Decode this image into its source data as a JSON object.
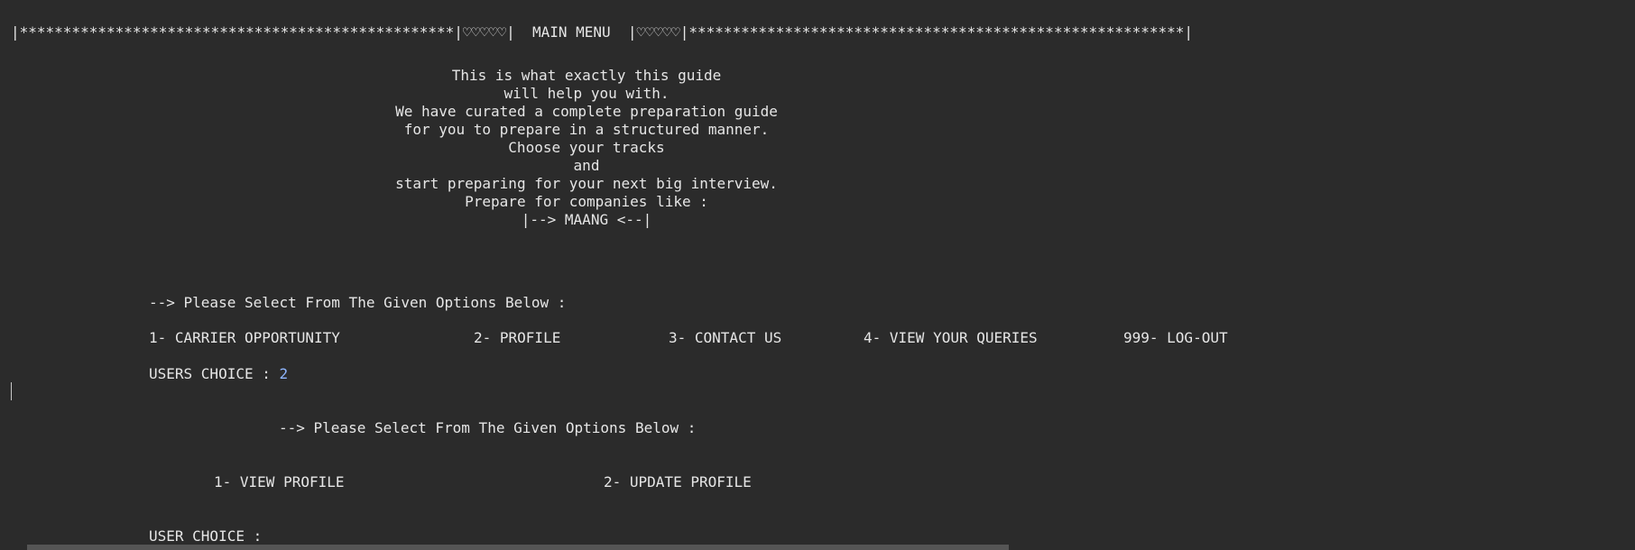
{
  "console": {
    "header_banner": "|**************************************************|♡♡♡♡♡|  MAIN MENU  |♡♡♡♡♡|*********************************************************|",
    "intro_lines": [
      "This is what exactly this guide",
      "will help you with.",
      "We have curated a complete preparation guide",
      "for you to prepare in a structured manner.",
      "Choose your tracks",
      "and",
      "start preparing for your next big interview.",
      "Prepare for companies like :",
      "|--> MAANG <--|"
    ],
    "main_prompt": "--> Please Select From The Given Options Below :",
    "main_options": [
      "1- CARRIER OPPORTUNITY",
      "2- PROFILE",
      "3- CONTACT US",
      "4- VIEW YOUR QUERIES",
      "999- LOG-OUT"
    ],
    "users_choice_label": "USERS CHOICE : ",
    "users_choice_value": "2",
    "sub_prompt": "--> Please Select From The Given Options Below :",
    "profile_options": [
      "1- VIEW PROFILE",
      "2- UPDATE PROFILE"
    ],
    "user_choice_label": "USER CHOICE :"
  }
}
